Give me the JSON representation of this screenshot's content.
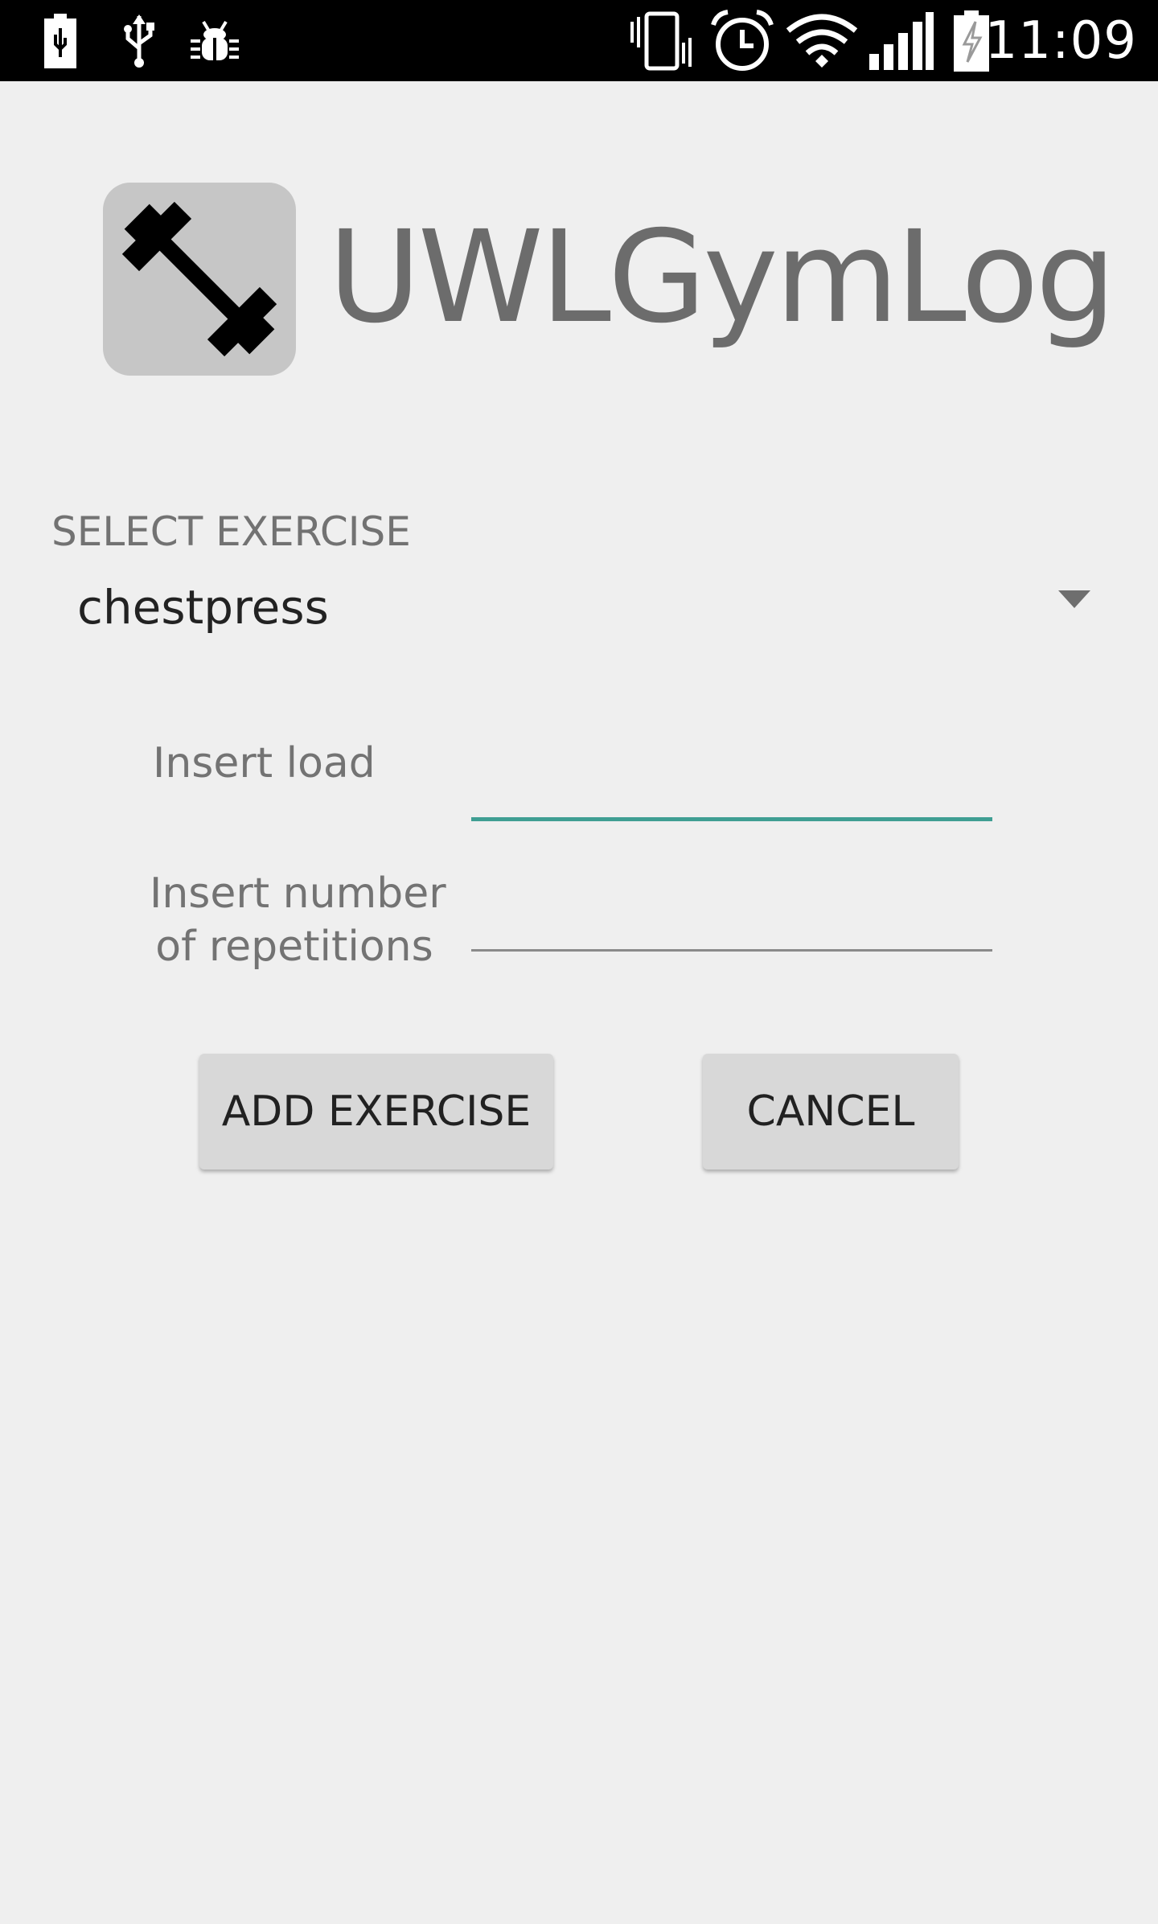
{
  "status_bar": {
    "left_icons": [
      "battery-plug-icon",
      "usb-icon",
      "debug-bug-icon"
    ],
    "right_icons": [
      "vibrate-icon",
      "alarm-icon",
      "wifi-icon",
      "signal-icon",
      "battery-charging-icon"
    ],
    "time": "11:09"
  },
  "header": {
    "logo_icon": "dumbbell-icon",
    "title": "UWLGymLog"
  },
  "exercise_spinner": {
    "label": "SELECT EXERCISE",
    "selected": "chestpress",
    "arrow_icon": "dropdown-arrow-icon"
  },
  "form": {
    "load_label": "Insert load",
    "load_value": "",
    "reps_label_line1": "Insert number",
    "reps_label_line2": "of repetitions",
    "reps_value": ""
  },
  "buttons": {
    "add_label": "ADD EXERCISE",
    "cancel_label": "CANCEL"
  },
  "colors": {
    "status_bar": "#000000",
    "background": "#efefef",
    "accent_focus_line": "#3f9e93",
    "button": "#d8d8d8",
    "title_text": "#6c6c6c"
  }
}
